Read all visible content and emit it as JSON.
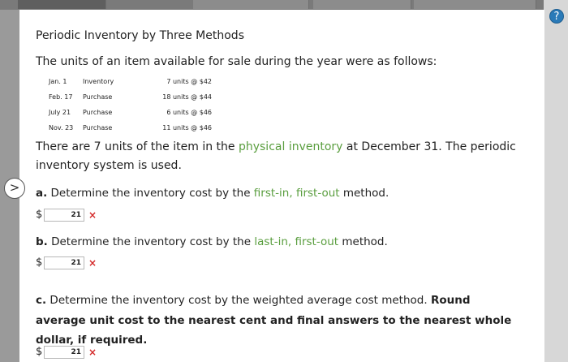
{
  "header": {
    "help_icon": "?"
  },
  "problem": {
    "title": "Periodic Inventory by Three Methods",
    "intro": "The units of an item available for sale during the year were as follows:",
    "inventory_rows": [
      {
        "date": "Jan. 1",
        "type": "Inventory",
        "qty": "7 units @ $42"
      },
      {
        "date": "Feb. 17",
        "type": "Purchase",
        "qty": "18 units @ $44"
      },
      {
        "date": "July 21",
        "type": "Purchase",
        "qty": "6 units @ $46"
      },
      {
        "date": "Nov. 23",
        "type": "Purchase",
        "qty": "11 units @ $46"
      }
    ],
    "paragraph_pre": "There are 7 units of the item in the ",
    "paragraph_link": "physical inventory",
    "paragraph_post": " at December 31. The periodic inventory system is used."
  },
  "questions": {
    "a": {
      "letter": "a.",
      "text_pre": " Determine the inventory cost by the ",
      "link": "first-in, first-out",
      "text_post": " method.",
      "answer": "21",
      "status": "×"
    },
    "b": {
      "letter": "b.",
      "text_pre": " Determine the inventory cost by the ",
      "link": "last-in, first-out",
      "text_post": " method.",
      "answer": "21",
      "status": "×"
    },
    "c": {
      "letter": "c.",
      "text": " Determine the inventory cost by the weighted average cost method. ",
      "bold": "Round average unit cost to the nearest cent and final answers to the nearest whole dollar, if required.",
      "answer": "21",
      "status": "×"
    }
  },
  "currency_symbol": "$",
  "nav": {
    "arrow": ">"
  }
}
